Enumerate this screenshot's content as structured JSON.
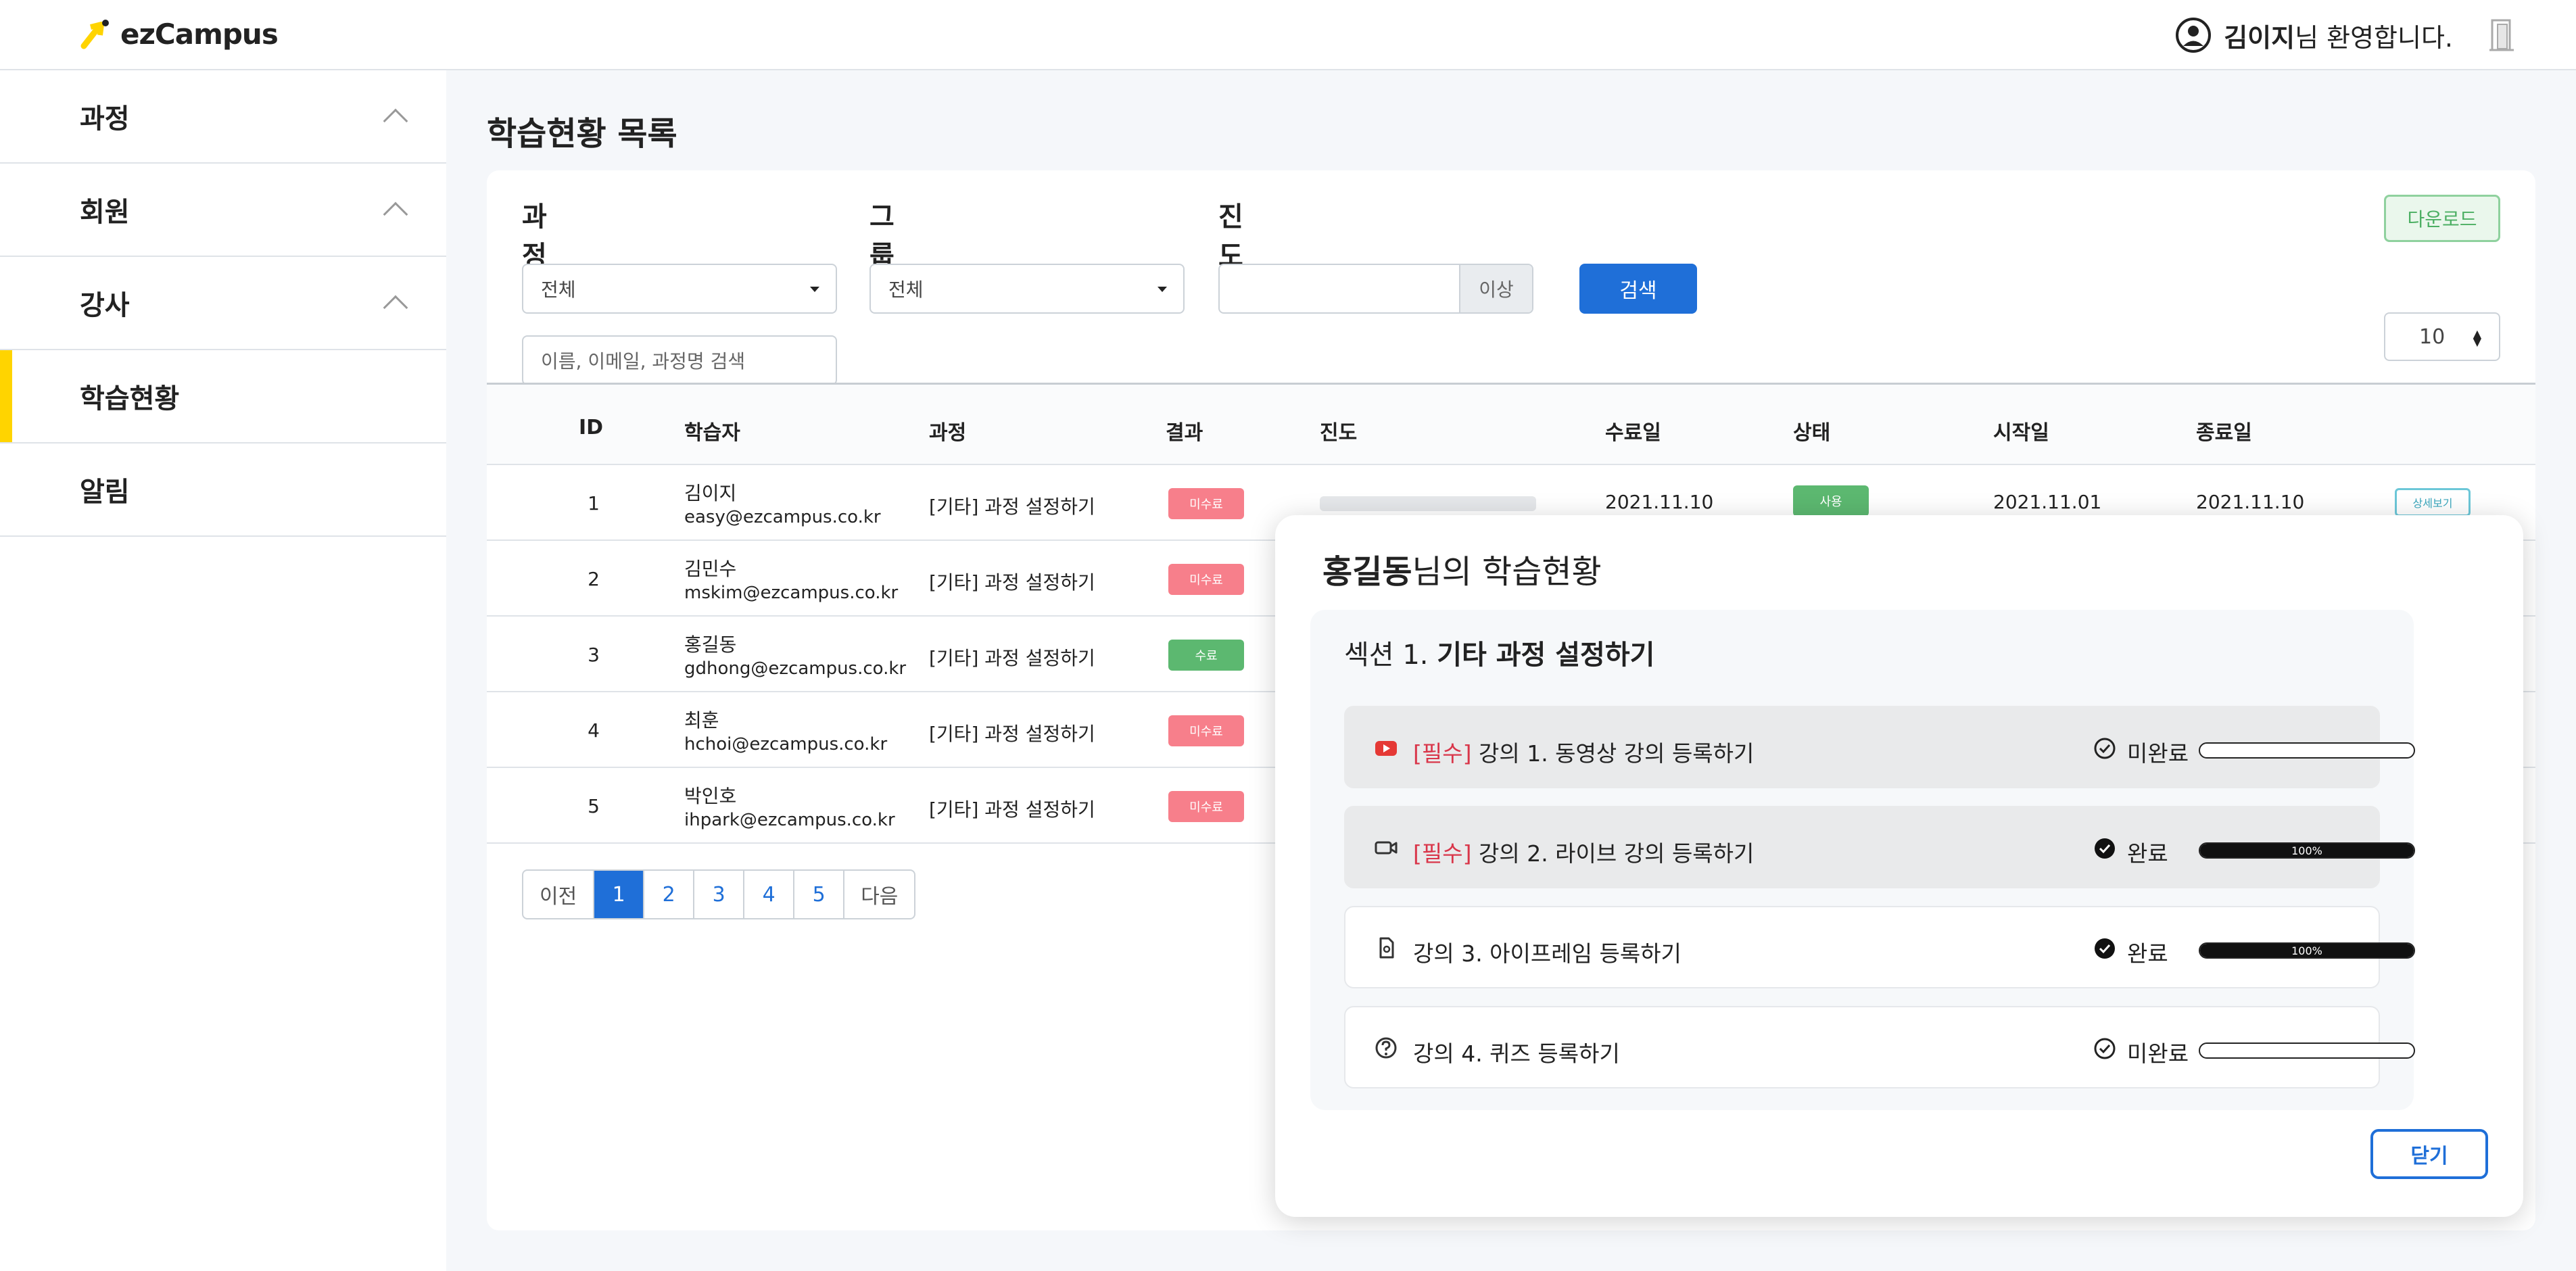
{
  "header": {
    "logo_text": "ezCampus",
    "user_name": "김이지",
    "welcome_suffix": "님 환영합니다."
  },
  "sidebar": {
    "items": [
      {
        "label": "과정"
      },
      {
        "label": "회원"
      },
      {
        "label": "강사"
      },
      {
        "label": "학습현황"
      },
      {
        "label": "알림"
      }
    ]
  },
  "page": {
    "title": "학습현황 목록"
  },
  "filters": {
    "course_label": "과정",
    "course_value": "전체",
    "group_label": "그룹",
    "group_value": "전체",
    "progress_label": "진도율",
    "progress_value": "",
    "progress_suffix": "이상",
    "search_button": "검색",
    "text_placeholder": "이름, 이메일, 과정명 검색",
    "download_button": "다운로드",
    "page_size": "10"
  },
  "table": {
    "headers": {
      "id": "ID",
      "learner": "학습자",
      "course": "과정",
      "result": "결과",
      "progress": "진도",
      "completed_date": "수료일",
      "status": "상태",
      "start_date": "시작일",
      "end_date": "종료일"
    },
    "rows": [
      {
        "id": "1",
        "name": "김이지",
        "email": "easy@ezcampus.co.kr",
        "course": "[기타] 과정 설정하기",
        "result": "미수료",
        "completed": "2021.11.10",
        "status": "사용",
        "start": "2021.11.01",
        "end": "2021.11.10",
        "action": "상세보기"
      },
      {
        "id": "2",
        "name": "김민수",
        "email": "mskim@ezcampus.co.kr",
        "course": "[기타] 과정 설정하기",
        "result": "미수료"
      },
      {
        "id": "3",
        "name": "홍길동",
        "email": "gdhong@ezcampus.co.kr",
        "course": "[기타] 과정 설정하기",
        "result": "수료"
      },
      {
        "id": "4",
        "name": "최훈",
        "email": "hchoi@ezcampus.co.kr",
        "course": "[기타] 과정 설정하기",
        "result": "미수료"
      },
      {
        "id": "5",
        "name": "박인호",
        "email": "ihpark@ezcampus.co.kr",
        "course": "[기타] 과정 설정하기",
        "result": "미수료"
      }
    ]
  },
  "pagination": {
    "prev": "이전",
    "pages": [
      "1",
      "2",
      "3",
      "4",
      "5"
    ],
    "next": "다음"
  },
  "modal": {
    "user_name": "홍길동",
    "title_suffix": "님의 학습현황",
    "section_prefix": "섹션 1.",
    "section_name": "기타 과정 설정하기",
    "lectures": [
      {
        "required": "[필수]",
        "title": "강의 1. 동영상 강의 등록하기",
        "status": "미완료",
        "progress": 0,
        "progress_label": ""
      },
      {
        "required": "[필수]",
        "title": "강의 2. 라이브 강의 등록하기",
        "status": "완료",
        "progress": 100,
        "progress_label": "100%"
      },
      {
        "required": "",
        "title": "강의 3. 아이프레임 등록하기",
        "status": "완료",
        "progress": 100,
        "progress_label": "100%"
      },
      {
        "required": "",
        "title": "강의 4. 퀴즈 등록하기",
        "status": "미완료",
        "progress": 0,
        "progress_label": ""
      }
    ],
    "close_button": "닫기"
  },
  "colors": {
    "brand_yellow": "#ffd400",
    "primary_blue": "#1f6fd8",
    "badge_red": "#f77f8b",
    "badge_green": "#5cb870",
    "required_red": "#d9364a"
  },
  "icons": {
    "logo": "ezcampus-logo-icon",
    "user": "user-circle-icon",
    "logout": "door-icon",
    "lecture_1": "youtube-icon",
    "lecture_2": "video-camera-icon",
    "lecture_3": "iframe-file-icon",
    "lecture_4": "question-circle-icon",
    "status_incomplete": "check-circle-outline-icon",
    "status_complete": "check-circle-filled-icon"
  }
}
